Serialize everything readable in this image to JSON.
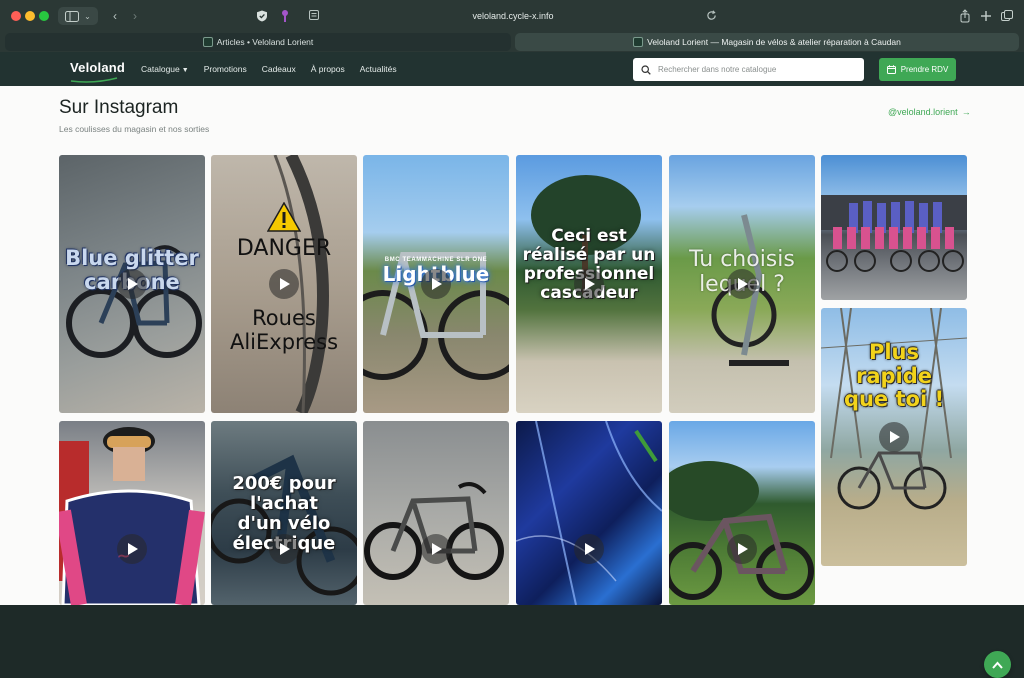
{
  "browser": {
    "url": "veloland.cycle-x.info",
    "tabs": [
      {
        "label": "Articles • Veloland Lorient"
      },
      {
        "label": "Veloland Lorient — Magasin de vélos & atelier réparation à Caudan"
      }
    ]
  },
  "site": {
    "logo": "Veloland",
    "nav": [
      {
        "label": "Catalogue",
        "has_caret": true
      },
      {
        "label": "Promotions"
      },
      {
        "label": "Cadeaux"
      },
      {
        "label": "À propos"
      },
      {
        "label": "Actualités"
      }
    ],
    "search_placeholder": "Rechercher dans notre catalogue",
    "cta_label": "Prendre RDV",
    "accent_color": "#3fa855"
  },
  "instagram": {
    "title": "Sur Instagram",
    "subtitle": "Les coulisses du magasin et nos sorties",
    "handle": "@veloland.lorient",
    "posts": [
      {
        "caption_lines": [
          "Blue glitter",
          "carbone"
        ],
        "is_video": true
      },
      {
        "caption_lines": [
          "DANGER",
          "Roues",
          "AliExpress"
        ],
        "is_video": true,
        "icon": "warning-icon"
      },
      {
        "brand": "BMC TEAMMACHINE SLR ONE",
        "caption_lines": [
          "Lightblue"
        ],
        "is_video": true
      },
      {
        "caption_lines": [
          "Ceci est",
          "réalisé par un",
          "professionnel",
          "cascadeur"
        ],
        "is_video": true
      },
      {
        "caption_lines": [
          "Tu choisis",
          "lequel ?"
        ],
        "is_video": true
      },
      {
        "caption_lines": [],
        "is_video": false
      },
      {
        "caption_lines": [],
        "is_video": true
      },
      {
        "caption_lines": [
          "200€ pour",
          "l'achat",
          "d'un vélo",
          "électrique"
        ],
        "is_video": true
      },
      {
        "caption_lines": [],
        "is_video": true
      },
      {
        "caption_lines": [],
        "is_video": true
      },
      {
        "caption_lines": [],
        "is_video": true
      },
      {
        "caption_lines": [
          "Plus",
          "rapide",
          "que toi !"
        ],
        "is_video": true
      }
    ]
  }
}
